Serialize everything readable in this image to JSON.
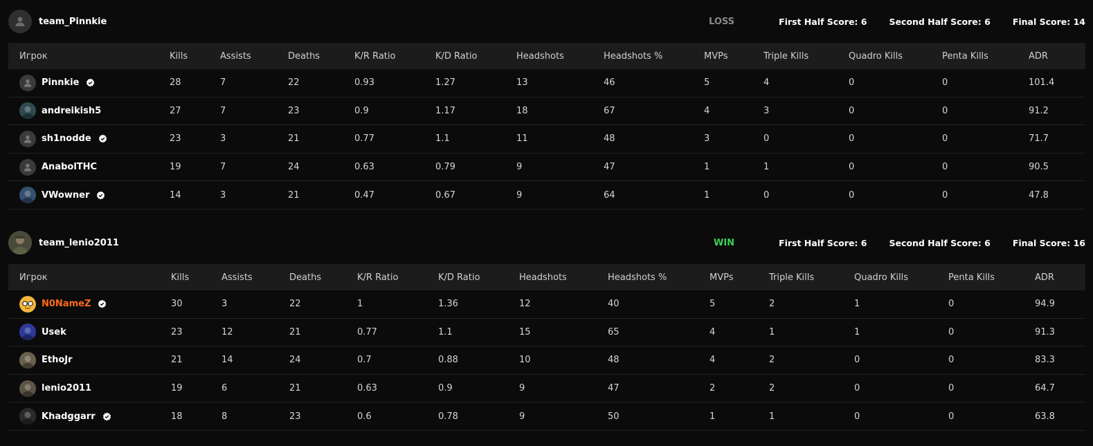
{
  "teams": [
    {
      "name": "team_Pinnkie",
      "result": "LOSS",
      "first_half": "First Half Score: 6",
      "second_half": "Second Half Score: 6",
      "final": "Final Score: 14",
      "columns": [
        "Игрок",
        "Kills",
        "Assists",
        "Deaths",
        "K/R Ratio",
        "K/D Ratio",
        "Headshots",
        "Headshots %",
        "MVPs",
        "Triple Kills",
        "Quadro Kills",
        "Penta Kills",
        "ADR"
      ],
      "players": [
        {
          "name": "Pinnkie",
          "verified": true,
          "stats": [
            "28",
            "7",
            "22",
            "0.93",
            "1.27",
            "13",
            "46",
            "5",
            "4",
            "0",
            "0",
            "101.4"
          ]
        },
        {
          "name": "andreikish5",
          "verified": false,
          "stats": [
            "27",
            "7",
            "23",
            "0.9",
            "1.17",
            "18",
            "67",
            "4",
            "3",
            "0",
            "0",
            "91.2"
          ]
        },
        {
          "name": "sh1nodde",
          "verified": true,
          "stats": [
            "23",
            "3",
            "21",
            "0.77",
            "1.1",
            "11",
            "48",
            "3",
            "0",
            "0",
            "0",
            "71.7"
          ]
        },
        {
          "name": "AnabolTHC",
          "verified": false,
          "stats": [
            "19",
            "7",
            "24",
            "0.63",
            "0.79",
            "9",
            "47",
            "1",
            "1",
            "0",
            "0",
            "90.5"
          ]
        },
        {
          "name": "VWowner",
          "verified": true,
          "stats": [
            "14",
            "3",
            "21",
            "0.47",
            "0.67",
            "9",
            "64",
            "1",
            "0",
            "0",
            "0",
            "47.8"
          ]
        }
      ]
    },
    {
      "name": "team_lenio2011",
      "result": "WIN",
      "first_half": "First Half Score: 6",
      "second_half": "Second Half Score: 6",
      "final": "Final Score: 16",
      "columns": [
        "Игрок",
        "Kills",
        "Assists",
        "Deaths",
        "K/R Ratio",
        "K/D Ratio",
        "Headshots",
        "Headshots %",
        "MVPs",
        "Triple Kills",
        "Quadro Kills",
        "Penta Kills",
        "ADR"
      ],
      "players": [
        {
          "name": "N0NameZ",
          "verified": true,
          "stats": [
            "30",
            "3",
            "22",
            "1",
            "1.36",
            "12",
            "40",
            "5",
            "2",
            "1",
            "0",
            "94.9"
          ]
        },
        {
          "name": "Usek",
          "verified": false,
          "stats": [
            "23",
            "12",
            "21",
            "0.77",
            "1.1",
            "15",
            "65",
            "4",
            "1",
            "1",
            "0",
            "91.3"
          ]
        },
        {
          "name": "EthoJr",
          "verified": false,
          "stats": [
            "21",
            "14",
            "24",
            "0.7",
            "0.88",
            "10",
            "48",
            "4",
            "2",
            "0",
            "0",
            "83.3"
          ]
        },
        {
          "name": "lenio2011",
          "verified": false,
          "stats": [
            "19",
            "6",
            "21",
            "0.63",
            "0.9",
            "9",
            "47",
            "2",
            "2",
            "0",
            "0",
            "64.7"
          ]
        },
        {
          "name": "Khadggarr",
          "verified": true,
          "stats": [
            "18",
            "8",
            "23",
            "0.6",
            "0.78",
            "9",
            "50",
            "1",
            "1",
            "0",
            "0",
            "63.8"
          ]
        }
      ]
    }
  ],
  "colors": {
    "background": "#0b0b0b",
    "header_row": "#1c1c1c",
    "win": "#3ccf5a",
    "loss": "#8a8a8a",
    "highlight_player": "#ff6a1a"
  },
  "icons": {
    "verified": "verified-check-icon",
    "default_avatar": "user-silhouette-icon"
  }
}
